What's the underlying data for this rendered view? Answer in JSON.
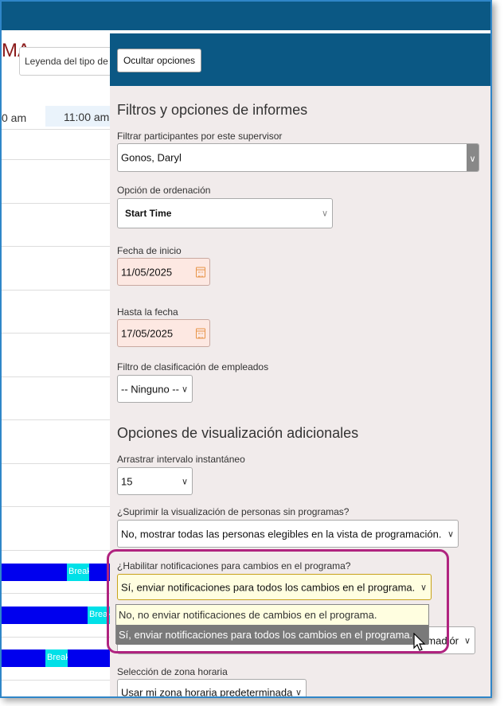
{
  "background_schedule": {
    "title_fragment": "MA",
    "legend_placeholder": "Leyenda del tipo de",
    "times": [
      "0 am",
      "11:00 am"
    ],
    "break_label": "Break"
  },
  "panel": {
    "hide_button": "Ocultar opciones",
    "section1_title": "Filtros y opciones de informes",
    "supervisor_label": "Filtrar participantes por este supervisor",
    "supervisor_value": "Gonos, Daryl",
    "sort_label": "Opción de ordenación",
    "sort_value": "Start Time",
    "start_label": "Fecha de inicio",
    "start_value": "11/05/2025",
    "end_label": "Hasta la fecha",
    "end_value": "17/05/2025",
    "classification_label": "Filtro de clasificación de empleados",
    "classification_value": "-- Ninguno --",
    "section2_title": "Opciones de visualización adicionales",
    "snap_label": "Arrastrar intervalo instantáneo",
    "snap_value": "15",
    "suppress_label": "¿Suprimir la visualización de personas sin programas?",
    "suppress_value": "No, mostrar todas las personas elegibles en la vista de programación.",
    "notify_label": "¿Habilitar notificaciones para cambios en el programa?",
    "notify_value": "Sí, enviar notificaciones para todos los cambios en el programa.",
    "notify_options": [
      "No, no enviar notificaciones de cambios en el programa.",
      "Sí, enviar notificaciones para todos los cambios en el programa."
    ],
    "hidden_field_fragment": "amadiór",
    "timezone_label": "Selección de zona horaria",
    "timezone_value": "Usar mi zona horaria predeterminada"
  },
  "colors": {
    "header": "#0b5884",
    "panel_bg": "#f1ebeb",
    "highlight": "#b0237f",
    "bar": "#0000ee",
    "break": "#00e0e8"
  }
}
